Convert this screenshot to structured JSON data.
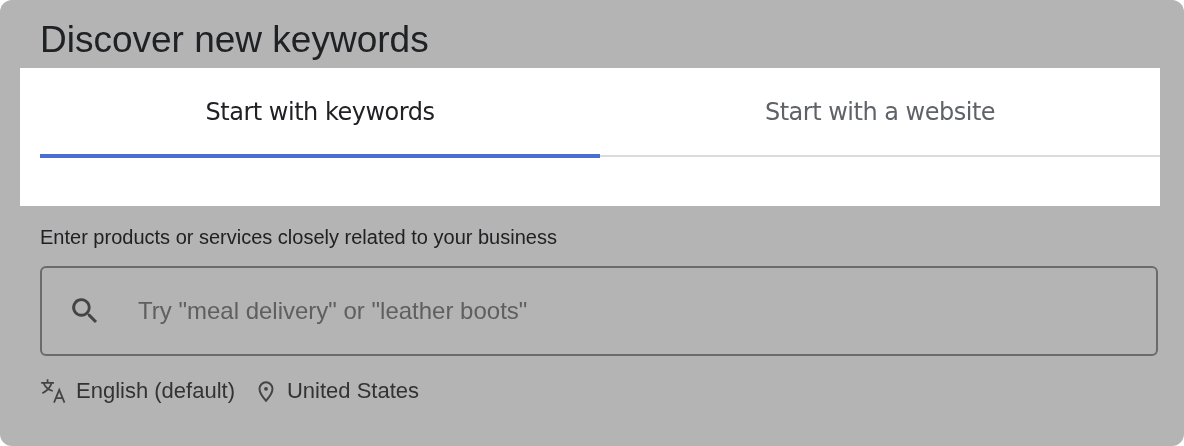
{
  "title": "Discover new keywords",
  "tabs": [
    {
      "label": "Start with keywords",
      "selected": true
    },
    {
      "label": "Start with a website",
      "selected": false
    }
  ],
  "field_label": "Enter products or services closely related to your business",
  "search": {
    "placeholder": "Try \"meal delivery\" or \"leather boots\""
  },
  "language": "English (default)",
  "location": "United States"
}
